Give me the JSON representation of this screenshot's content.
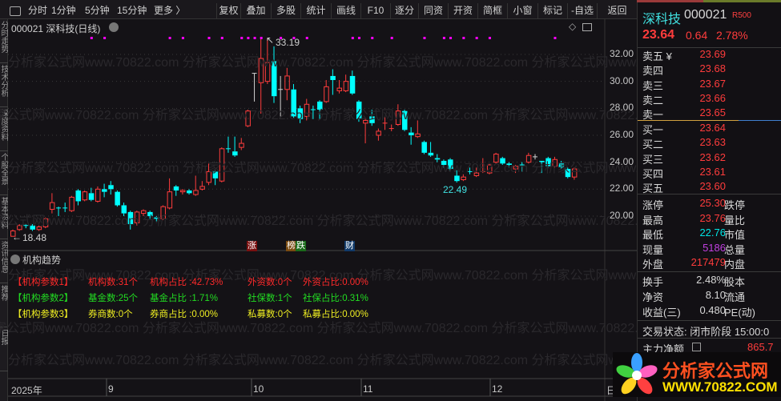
{
  "toolbar": {
    "period_items": [
      "分时",
      "1分钟",
      "5分钟",
      "15分钟",
      "更多 〉"
    ],
    "buttons": [
      "复权",
      "叠加",
      "多股",
      "统计",
      "画线",
      "F10",
      "逐分",
      "同资",
      "开资",
      "简框",
      "小窗",
      "标记",
      "-自选",
      "返回"
    ]
  },
  "left_tabs": [
    "分时走势",
    "技术分析",
    "深度资料",
    "个股全景",
    "基本资料",
    "资讯信息",
    "推荐",
    "日报"
  ],
  "chart": {
    "title": "000021 深科技(日线)",
    "high_label": "33.19",
    "low_label": "22.49",
    "start_label": "18.48",
    "markers": [
      "涨",
      "榜",
      "跌",
      "财"
    ],
    "price_axis": [
      "32.00",
      "30.00",
      "28.00",
      "26.00",
      "24.00",
      "22.00",
      "20.00"
    ],
    "date_axis": [
      "2025年",
      "9",
      "10",
      "11",
      "12",
      "日"
    ],
    "watermark": "分析家公式网www.70822.com 分析家公式网www.70822.com 分析家公式网www.70822.com 分析家公式网www.70822.com",
    "colors": {
      "up": "#ff3c3c",
      "down": "#00ffff",
      "flat": "#d0d0d0",
      "signal": "#ff00ff"
    },
    "signal_indices": [
      12,
      14,
      24,
      26,
      30,
      32,
      35,
      36,
      37,
      38,
      41,
      43,
      45,
      52,
      53,
      55,
      58,
      63,
      66,
      67,
      69,
      71,
      73,
      83
    ],
    "candles": [
      [
        18.5,
        18.9,
        19.0,
        18.48
      ],
      [
        19.0,
        19.3,
        19.4,
        18.9
      ],
      [
        19.3,
        19.3,
        19.4,
        19.1,
        "c"
      ],
      [
        19.3,
        19.0,
        19.4,
        18.9
      ],
      [
        19.0,
        19.2,
        19.3,
        18.9
      ],
      [
        19.2,
        19.8,
        19.9,
        19.1
      ],
      [
        20.5,
        21.0,
        21.7,
        20.2
      ],
      [
        20.6,
        20.6,
        20.7,
        20.0,
        "c"
      ],
      [
        20.6,
        20.6,
        21.0,
        20.3,
        "c"
      ],
      [
        20.4,
        21.4,
        21.5,
        20.3
      ],
      [
        21.9,
        21.1,
        22.0,
        20.8
      ],
      [
        21.2,
        21.8,
        21.9,
        21.1
      ],
      [
        21.7,
        21.2,
        22.1,
        21.1
      ],
      [
        21.1,
        22.0,
        22.2,
        21.0
      ],
      [
        22.0,
        21.8,
        22.4,
        21.4
      ],
      [
        22.3,
        22.0,
        22.6,
        21.6
      ],
      [
        21.8,
        20.8,
        21.9,
        20.7
      ],
      [
        20.8,
        20.2,
        21.0,
        20.0
      ],
      [
        20.3,
        19.4,
        20.4,
        19.0
      ],
      [
        19.5,
        20.3,
        20.4,
        19.3
      ],
      [
        20.2,
        20.4,
        20.5,
        20.0
      ],
      [
        20.3,
        20.0,
        20.4,
        19.8
      ],
      [
        19.9,
        19.8,
        20.0,
        19.6
      ],
      [
        19.8,
        20.7,
        20.8,
        19.7
      ],
      [
        20.6,
        21.8,
        22.8,
        20.5
      ],
      [
        22.2,
        21.9,
        22.3,
        21.5
      ],
      [
        21.8,
        21.9,
        22.0,
        21.6
      ],
      [
        21.9,
        21.7,
        22.0,
        21.6
      ],
      [
        21.6,
        21.9,
        23.0,
        21.5
      ],
      [
        22.0,
        22.2,
        22.6,
        21.9
      ],
      [
        22.5,
        23.3,
        23.9,
        22.3
      ],
      [
        23.3,
        22.8,
        23.4,
        22.3
      ],
      [
        22.6,
        25.0,
        25.1,
        22.5
      ],
      [
        25.0,
        25.0,
        25.9,
        24.7,
        "c"
      ],
      [
        24.8,
        24.5,
        25.9,
        24.4
      ],
      [
        25.1,
        25.4,
        25.8,
        24.9
      ],
      [
        26.7,
        27.8,
        27.9,
        26.6
      ],
      [
        30.6,
        30.6,
        30.6,
        28.5,
        "w"
      ],
      [
        29.9,
        31.7,
        33.2,
        27.6
      ],
      [
        30.0,
        31.4,
        33.19,
        29.8
      ],
      [
        31.5,
        28.9,
        32.6,
        28.4
      ],
      [
        29.4,
        29.4,
        30.4,
        27.4,
        "w"
      ],
      [
        29.4,
        30.4,
        31.0,
        28.6
      ],
      [
        29.4,
        27.4,
        29.8,
        27.3
      ],
      [
        28.0,
        27.2,
        28.2,
        26.9
      ],
      [
        27.4,
        28.3,
        28.7,
        27.1
      ],
      [
        27.9,
        27.9,
        28.2,
        27.2,
        "c"
      ],
      [
        28.5,
        27.9,
        28.6,
        27.2
      ],
      [
        28.5,
        29.6,
        30.1,
        28.4
      ],
      [
        30.4,
        30.1,
        30.9,
        29.0
      ],
      [
        29.3,
        29.5,
        30.1,
        29.1
      ],
      [
        29.3,
        30.0,
        30.5,
        29.2
      ],
      [
        30.4,
        29.1,
        30.8,
        29.0
      ],
      [
        28.5,
        27.2,
        28.6,
        27.0
      ],
      [
        26.9,
        27.1,
        27.3,
        25.4
      ],
      [
        27.4,
        26.9,
        27.9,
        26.7
      ],
      [
        26.0,
        26.3,
        26.5,
        25.6
      ],
      [
        26.9,
        26.9,
        27.4,
        26.4,
        "r"
      ],
      [
        26.5,
        26.5,
        26.8,
        26.3,
        "r"
      ],
      [
        26.8,
        27.8,
        28.3,
        26.7
      ],
      [
        27.8,
        26.4,
        27.9,
        26.3
      ],
      [
        26.2,
        26.0,
        26.6,
        25.3
      ],
      [
        25.9,
        26.1,
        27.1,
        25.8
      ],
      [
        25.5,
        24.7,
        25.6,
        24.6
      ],
      [
        24.7,
        24.5,
        25.5,
        24.4
      ],
      [
        24.3,
        24.2,
        24.6,
        24.0
      ],
      [
        24.1,
        23.8,
        24.2,
        23.6
      ],
      [
        24.2,
        23.5,
        24.3,
        23.4
      ],
      [
        23.0,
        22.6,
        23.4,
        22.49
      ],
      [
        22.7,
        22.9,
        23.1,
        22.6
      ],
      [
        23.3,
        23.3,
        23.6,
        23.1,
        "c"
      ],
      [
        23.0,
        23.2,
        23.6,
        22.9
      ],
      [
        23.3,
        23.3,
        24.3,
        23.2,
        "r"
      ],
      [
        23.2,
        23.8,
        23.9,
        23.1
      ],
      [
        24.0,
        24.6,
        24.7,
        23.9
      ],
      [
        24.3,
        23.9,
        24.4,
        23.8
      ],
      [
        23.9,
        23.8,
        24.0,
        23.6
      ],
      [
        23.5,
        23.7,
        23.8,
        23.2
      ],
      [
        23.8,
        23.8,
        24.0,
        23.3,
        "c"
      ],
      [
        24.0,
        24.5,
        24.7,
        23.9
      ],
      [
        24.4,
        24.4,
        24.6,
        24.2,
        "w"
      ],
      [
        24.1,
        24.0,
        24.1,
        23.2
      ],
      [
        24.3,
        23.7,
        24.4,
        23.6
      ],
      [
        23.7,
        24.2,
        24.4,
        23.6
      ],
      [
        23.9,
        23.6,
        24.1,
        23.5
      ],
      [
        23.5,
        22.9,
        23.6,
        22.8
      ],
      [
        22.9,
        23.5,
        23.6,
        22.7
      ]
    ]
  },
  "indicator": {
    "title": "机构趋势",
    "rows": [
      {
        "label": "【机构参数1】",
        "color": "#ff2a2a",
        "items": [
          "机构数:31个",
          "机构占比  :42.73%",
          "外资数:0个",
          "外资占比:0.00%"
        ]
      },
      {
        "label": "【机构参数2】",
        "color": "#22dd22",
        "items": [
          "基金数:25个",
          "基金占比  :1.71%",
          "社保数:1个",
          "社保占比:0.31%"
        ]
      },
      {
        "label": "【机构参数3】",
        "color": "#eeee22",
        "items": [
          "券商数:0个",
          "券商占比  :0.00%",
          "私募数:0个",
          "私募占比:0.00%"
        ]
      }
    ]
  },
  "quote": {
    "name": "深科技",
    "code": "000021",
    "badge": "R500",
    "price": "23.64",
    "change": "0.64",
    "pct": "2.78%",
    "asks": [
      {
        "label": "卖五 ¥",
        "price": "23.69"
      },
      {
        "label": "卖四",
        "price": "23.68"
      },
      {
        "label": "卖三",
        "price": "23.67"
      },
      {
        "label": "卖二",
        "price": "23.66"
      },
      {
        "label": "卖一",
        "price": "23.65"
      }
    ],
    "bids": [
      {
        "label": "买一",
        "price": "23.64"
      },
      {
        "label": "买二",
        "price": "23.63"
      },
      {
        "label": "买三",
        "price": "23.62"
      },
      {
        "label": "买四",
        "price": "23.61"
      },
      {
        "label": "买五",
        "price": "23.60"
      }
    ],
    "stats": [
      {
        "label": "涨停",
        "value": "25.30",
        "color": "#ff3c3c",
        "label2": "跌停"
      },
      {
        "label": "最高",
        "value": "23.76",
        "color": "#ff3c3c",
        "label2": "量比"
      },
      {
        "label": "最低",
        "value": "22.76",
        "color": "#00e5e5",
        "label2": "市值"
      },
      {
        "label": "现量",
        "value": "5186",
        "color": "#c040e0",
        "label2": "总量"
      },
      {
        "label": "外盘",
        "value": "217479",
        "color": "#ff3c3c",
        "label2": "内盘"
      }
    ],
    "stats2": [
      {
        "label": "换手",
        "value": "2.48%",
        "label2": "股本"
      },
      {
        "label": "净资",
        "value": "8.10",
        "label2": "流通"
      },
      {
        "label": "收益(三)",
        "value": "0.480",
        "label2": "PE(动)"
      }
    ],
    "status": "交易状态: 闭市阶段 15:00:0",
    "main_net_label": "主力净额",
    "main_net_value": "865.7"
  },
  "logo": {
    "text": "分析家公式网",
    "url": "WWW.70822.COM"
  }
}
